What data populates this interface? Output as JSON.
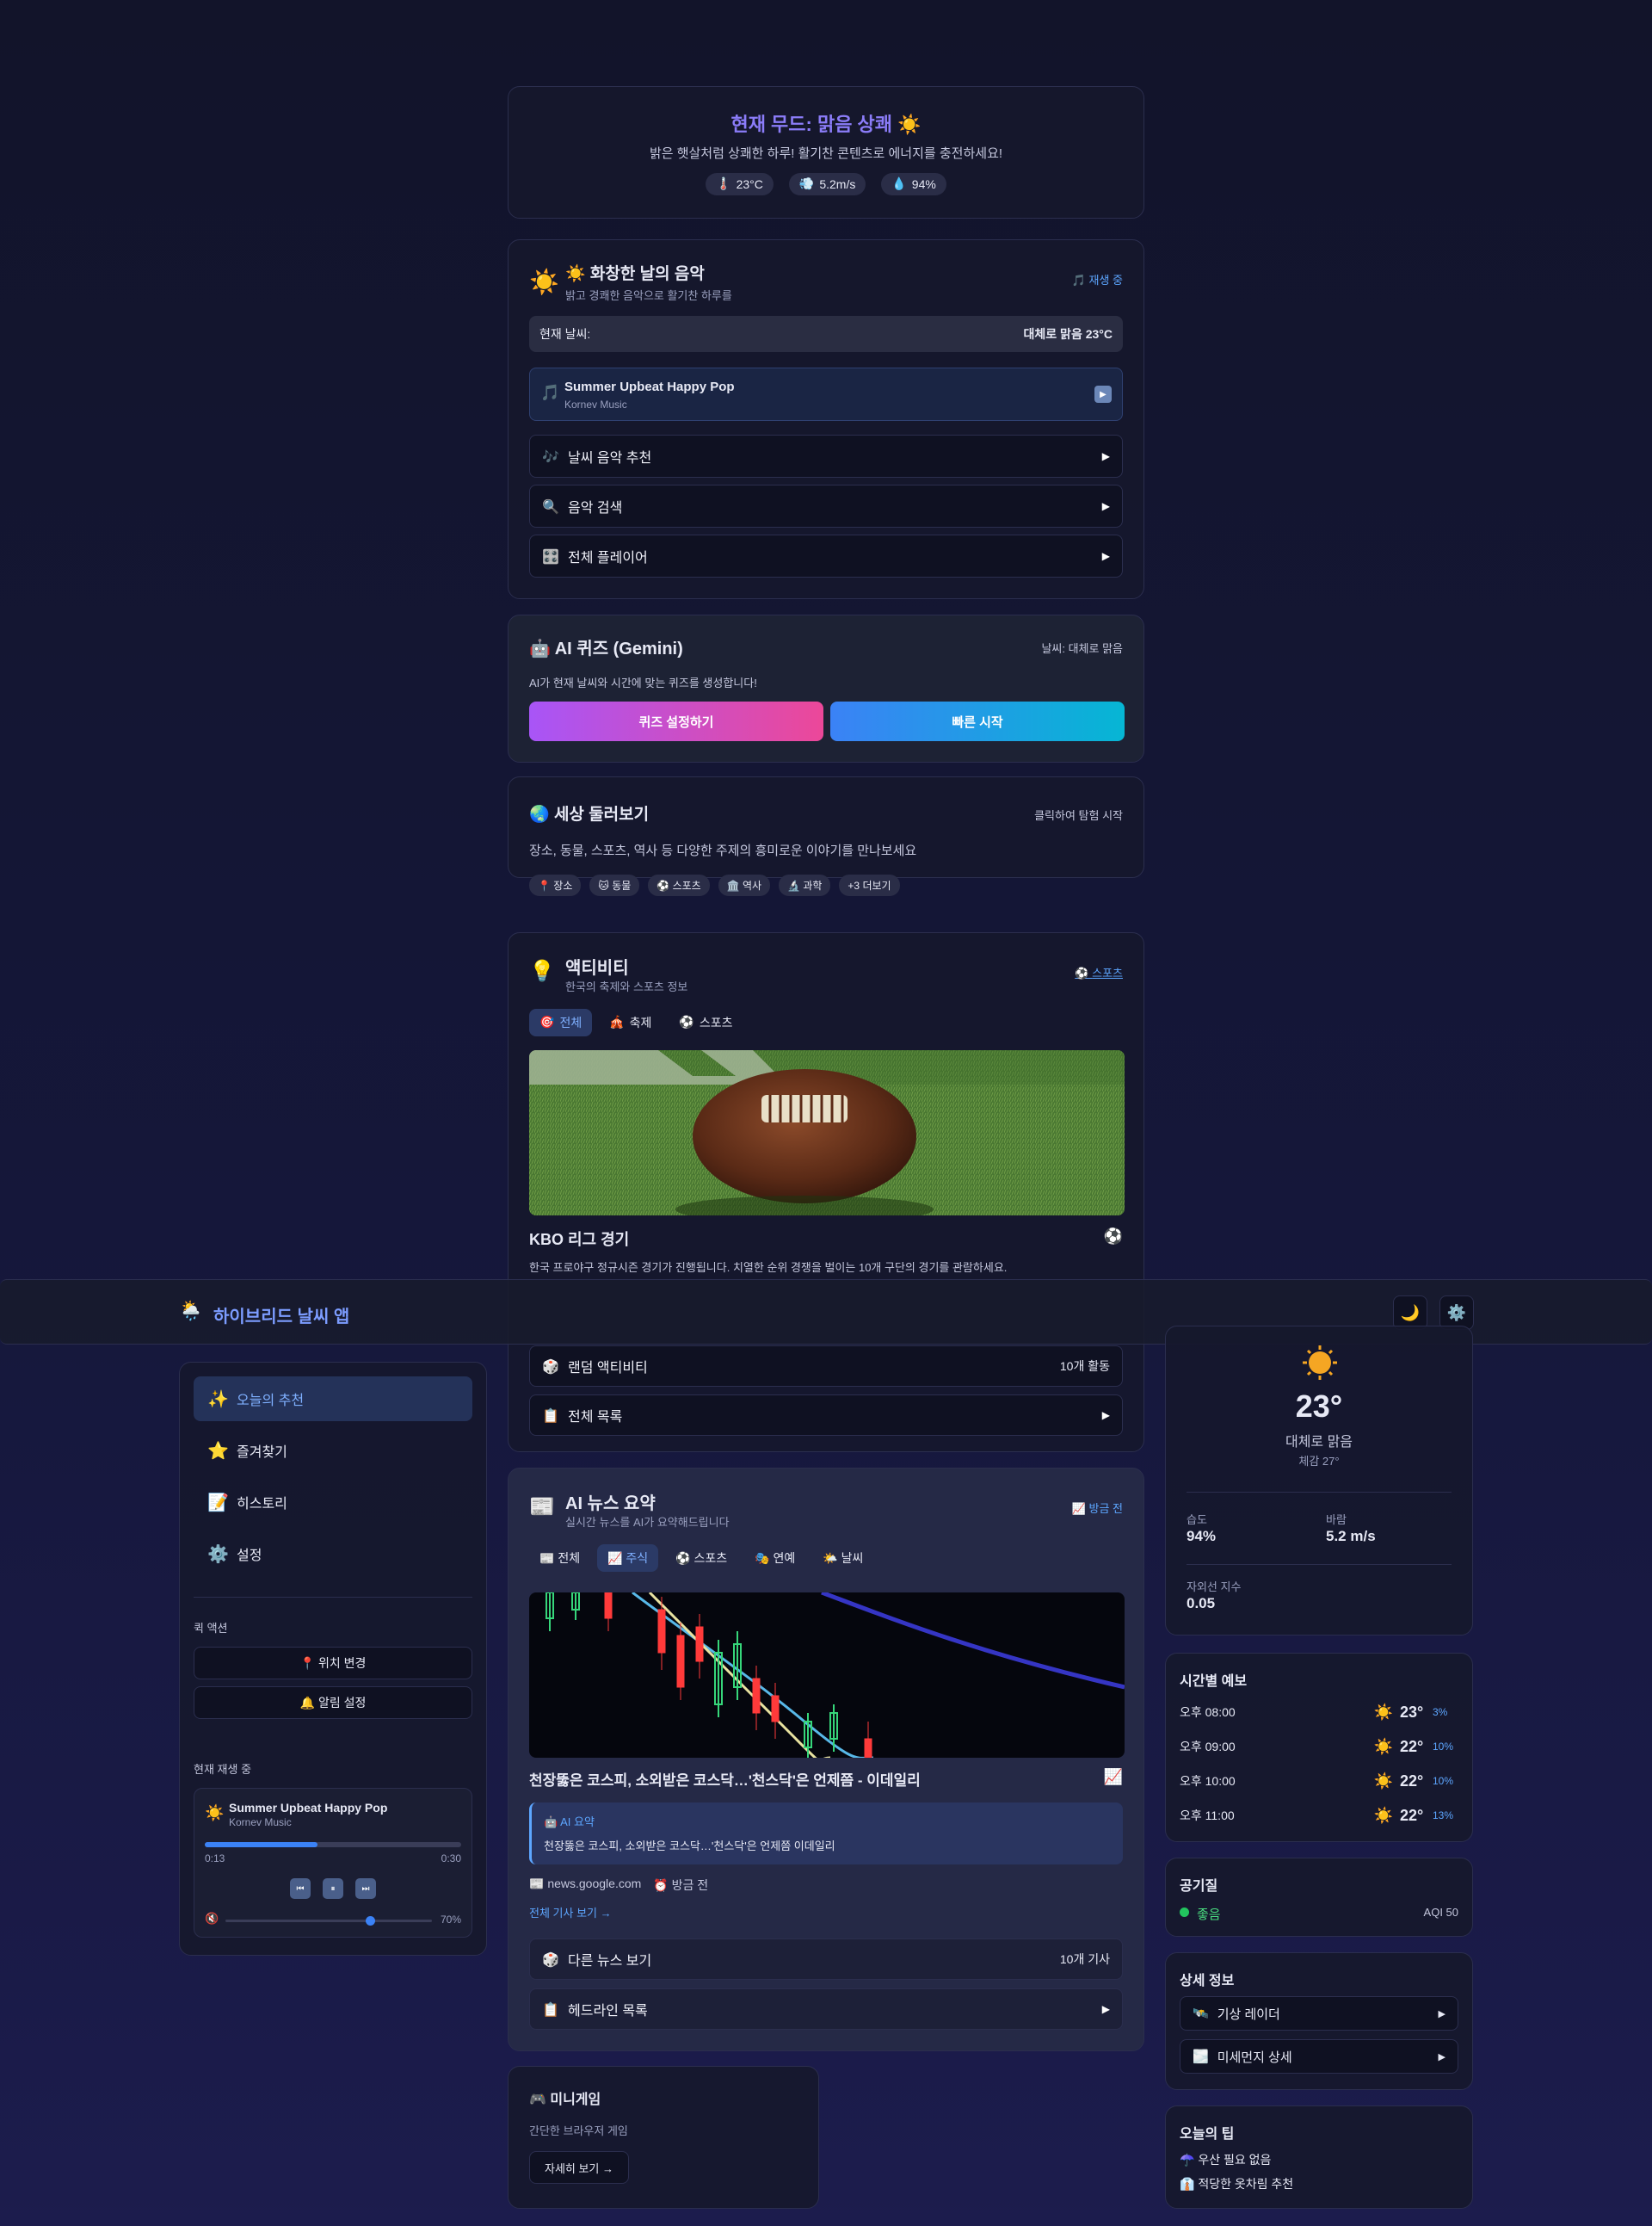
{
  "mood": {
    "title": "현재 무드: 맑음 상쾌 ☀️",
    "subtitle": "밝은 햇살처럼 상쾌한 하루! 활기찬 콘텐츠로 에너지를 충전하세요!",
    "temp": "23°C",
    "wind": "5.2m/s",
    "humidity": "94%"
  },
  "music": {
    "title": "☀️ 화창한 날의 음악",
    "subtitle": "밝고 경쾌한 음악으로 활기찬 하루를",
    "status": "재생 중",
    "weather_label": "현재 날씨:",
    "weather_value": "대체로 맑음 23°C",
    "track_title": "Summer Upbeat Happy Pop",
    "track_artist": "Kornev Music",
    "btn_recommend": "날씨 음악 추천",
    "btn_search": "음악 검색",
    "btn_player": "전체 플레이어"
  },
  "quiz": {
    "title": "AI 퀴즈 (Gemini)",
    "weather": "날씨: 대체로 맑음",
    "desc": "AI가 현재 날씨와 시간에 맞는 퀴즈를 생성합니다!",
    "btn_settings": "퀴즈 설정하기",
    "btn_quick": "빠른 시작"
  },
  "explore": {
    "title": "세상 둘러보기",
    "hint": "클릭하여 탐험 시작",
    "desc": "장소, 동물, 스포츠, 역사 등 다양한 주제의 흥미로운 이야기를 만나보세요",
    "tags": [
      "📍 장소",
      "🐱 동물",
      "⚽ 스포츠",
      "🏛️ 역사",
      "🔬 과학",
      "+3 더보기"
    ]
  },
  "activity": {
    "title": "액티비티",
    "subtitle": "한국의 축제와 스포츠 정보",
    "link": "스포츠",
    "tabs": [
      "전체",
      "축제",
      "스포츠"
    ],
    "item_title": "KBO 리그 경기",
    "item_desc": "한국 프로야구 정규시즌 경기가 진행됩니다. 치열한 순위 경쟁을 벌이는 10개 구단의 경기를 관람하세요.",
    "btn_random": "랜덤 액티비티",
    "random_count": "10개 활동",
    "btn_list": "전체 목록"
  },
  "header": {
    "app_title": "하이브리드 날씨 앱"
  },
  "sidebar": {
    "items": [
      {
        "icon": "✨",
        "label": "오늘의 추천"
      },
      {
        "icon": "⭐",
        "label": "즐겨찾기"
      },
      {
        "icon": "📝",
        "label": "히스토리"
      },
      {
        "icon": "⚙️",
        "label": "설정"
      }
    ],
    "quick_title": "퀵 액션",
    "quick_location": "📍 위치 변경",
    "quick_alarm": "🔔 알림 설정",
    "now_playing_title": "현재 재생 중",
    "np_track": "Summer Upbeat Happy Pop",
    "np_artist": "Kornev Music",
    "np_elapsed": "0:13",
    "np_total": "0:30",
    "np_progress": 0.44,
    "np_volume_text": "70%",
    "np_volume": 0.7
  },
  "news": {
    "title": "AI 뉴스 요약",
    "subtitle": "실시간 뉴스를 AI가 요약해드립니다",
    "status": "방금 전",
    "tabs": [
      "📰 전체",
      "📈 주식",
      "⚽ 스포츠",
      "🎭 연예",
      "🌤️ 날씨"
    ],
    "headline": "천장뚫은 코스피, 소외받은 코스닥…'천스닥'은 언제쯤 - 이데일리",
    "ai_label": "AI 요약",
    "ai_text": "천장뚫은 코스피, 소외받은 코스닥…'천스닥'은 언제쯤 이데일리",
    "source": "news.google.com",
    "time": "방금 전",
    "read_more": "전체 기사 보기 →",
    "btn_other": "다른 뉴스 보기",
    "other_count": "10개 기사",
    "btn_headlines": "헤드라인 목록"
  },
  "minigame": {
    "title": "🎮 미니게임",
    "desc": "간단한 브라우저 게임",
    "btn": "자세히 보기 →"
  },
  "weather": {
    "temp": "23°",
    "condition": "대체로 맑음",
    "feels": "체감 27°",
    "humidity_label": "습도",
    "humidity": "94%",
    "wind_label": "바람",
    "wind": "5.2 m/s",
    "uv_label": "자외선 지수",
    "uv": "0.05"
  },
  "hourly": {
    "title": "시간별 예보",
    "rows": [
      {
        "time": "오후 08:00",
        "temp": "23°",
        "pct": "3%"
      },
      {
        "time": "오후 09:00",
        "temp": "22°",
        "pct": "10%"
      },
      {
        "time": "오후 10:00",
        "temp": "22°",
        "pct": "10%"
      },
      {
        "time": "오후 11:00",
        "temp": "22°",
        "pct": "13%"
      }
    ]
  },
  "air": {
    "title": "공기질",
    "status": "좋음",
    "aqi": "AQI 50"
  },
  "detail": {
    "title": "상세 정보",
    "radar": "기상 레이더",
    "dust": "미세먼지 상세"
  },
  "tips": {
    "title": "오늘의 팁",
    "items": [
      "☂️ 우산 필요 없음",
      "👔 적당한 옷차림 추천"
    ]
  },
  "colors": {
    "accent": "#7c6cf6",
    "link": "#5da6ff",
    "quiz_left": "#a855f7",
    "quiz_right": "#3b82f6"
  }
}
